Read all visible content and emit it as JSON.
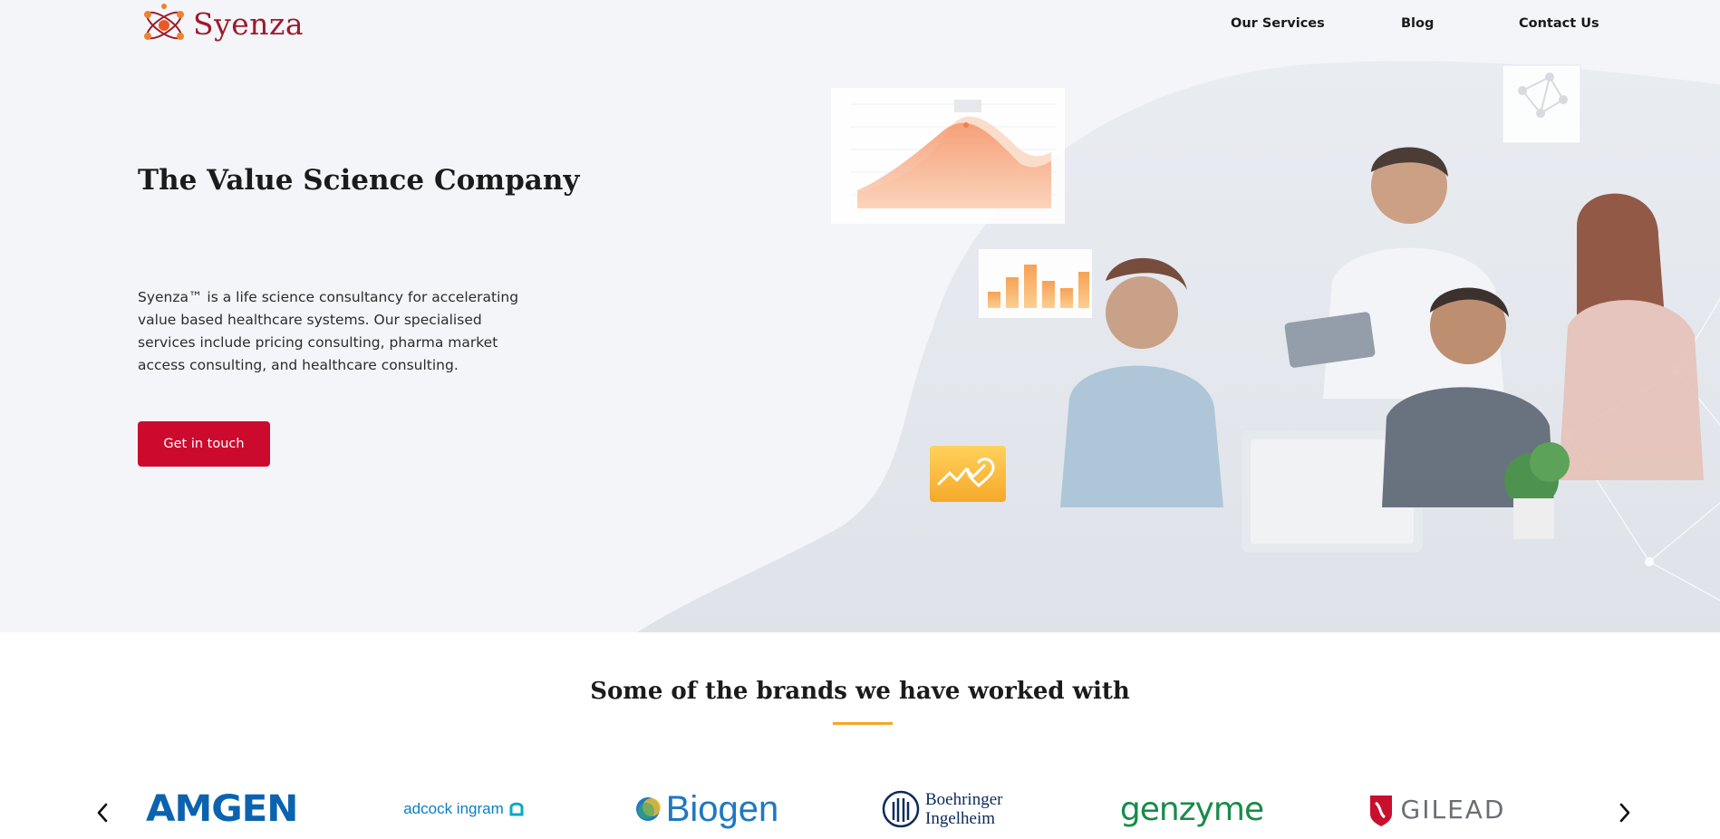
{
  "header": {
    "logo_text": "Syenza",
    "nav": [
      {
        "label": "Our Services"
      },
      {
        "label": "Blog"
      },
      {
        "label": "Contact Us"
      }
    ]
  },
  "hero": {
    "title": "The Value Science Company",
    "description": "Syenza™ is a life science consultancy for accelerating value based healthcare systems. Our specialised services include pricing consulting, pharma market access consulting, and healthcare consulting.",
    "cta_label": "Get in touch"
  },
  "brands": {
    "title": "Some of the brands we have worked with",
    "logos": [
      {
        "name": "AMGEN"
      },
      {
        "name": "adcock ingram"
      },
      {
        "name": "Biogen"
      },
      {
        "name": "Boehringer Ingelheim"
      },
      {
        "name": "genzyme"
      },
      {
        "name": "GILEAD"
      }
    ]
  },
  "colors": {
    "accent": "#cc0a2e",
    "brand": "#9b1c2c",
    "underline": "#f5a623",
    "hero_bg": "#f4f5f9"
  },
  "icons": {
    "prev": "chevron-left-icon",
    "next": "chevron-right-icon",
    "badge": "heart-growth-icon",
    "network": "network-icon"
  }
}
